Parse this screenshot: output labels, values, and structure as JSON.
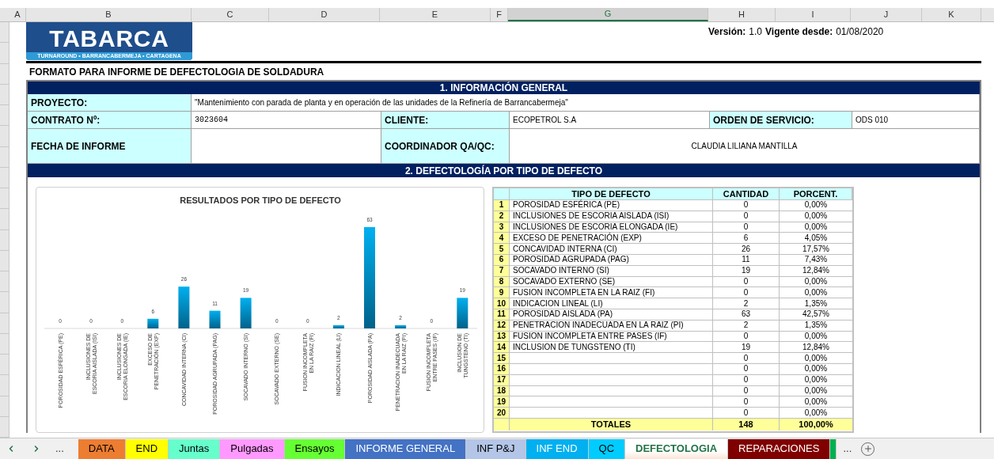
{
  "column_headers": [
    {
      "label": "A",
      "selected": false
    },
    {
      "label": "B",
      "selected": false
    },
    {
      "label": "C",
      "selected": false
    },
    {
      "label": "D",
      "selected": false
    },
    {
      "label": "E",
      "selected": false
    },
    {
      "label": "F",
      "selected": false
    },
    {
      "label": "G",
      "selected": true
    },
    {
      "label": "H",
      "selected": false
    },
    {
      "label": "I",
      "selected": false
    },
    {
      "label": "J",
      "selected": false
    },
    {
      "label": "K",
      "selected": false
    }
  ],
  "logo": {
    "name": "TABARCA",
    "tagline": "TURNAROUND • BARRANCABERMEJA • CARTAGENA"
  },
  "version": {
    "version_label": "Versión:",
    "version_value": "1.0",
    "valid_label": "Vigente desde:",
    "valid_value": "01/08/2020"
  },
  "form_title": "FORMATO PARA INFORME DE DEFECTOLOGIA DE SOLDADURA",
  "section_1": {
    "title": "1. INFORMACIÓN GENERAL",
    "proyecto": {
      "label": "PROYECTO:",
      "value": "\"Mantenimiento con parada de planta y en operación de las unidades de la Refinería de Barrancabermeja\""
    },
    "contrato": {
      "label": "CONTRATO Nº:",
      "value": "3023604"
    },
    "cliente": {
      "label": "CLIENTE:",
      "value": "ECOPETROL S.A"
    },
    "orden": {
      "label": "ORDEN DE SERVICIO:",
      "value": "ODS 010"
    },
    "fecha": {
      "label": "FECHA DE INFORME"
    },
    "coordinador": {
      "label": "COORDINADOR QA/QC:",
      "value": "CLAUDIA LILIANA MANTILLA"
    }
  },
  "section_2": {
    "title": "2. DEFECTOLOGÍA POR TIPO DE DEFECTO",
    "chart_data": {
      "type": "bar",
      "title": "RESULTADOS POR TIPO DE DEFECTO",
      "data_labels": true,
      "categories": [
        "POROSIDAD ESFÉRICA (PE)",
        "INCLUSIONES DE ESCORIA AISLADA (ISI)",
        "INCLUSIONES DE ESCORIA ELONGADA (IE)",
        "EXCESO DE PENETRACIÓN (EXP)",
        "CONCAVIDAD INTERNA (CI)",
        "POROSIDAD AGRUPADA (PAG)",
        "SOCAVADO INTERNO (SI)",
        "SOCAVADO EXTERNO (SE)",
        "FUSION INCOMPLETA EN LA RAIZ (FI)",
        "INDICACION LINEAL (LI)",
        "POROSIDAD AISLADA (PA)",
        "PENETRACION INADECUADA EN LA RAIZ (PI)",
        "FUSION INCOMPLETA ENTRE PASES (IF)",
        "INCLUSION DE TUNGSTENO (TI)"
      ],
      "series": [
        {
          "color": "#00b0f0",
          "values": [
            0,
            0,
            0,
            6,
            26,
            11,
            19,
            0,
            0,
            2,
            63,
            2,
            0,
            19
          ]
        }
      ]
    },
    "table": {
      "columns": [
        "TIPO DE DEFECTO",
        "CANTIDAD",
        "PORCENT."
      ],
      "rows": [
        {
          "number": "1",
          "defect": "POROSIDAD ESFÉRICA (PE)",
          "quantity": "0",
          "percent": "0,00%"
        },
        {
          "number": "2",
          "defect": "INCLUSIONES DE ESCORIA AISLADA (ISI)",
          "quantity": "0",
          "percent": "0,00%"
        },
        {
          "number": "3",
          "defect": "INCLUSIONES DE ESCORIA ELONGADA (IE)",
          "quantity": "0",
          "percent": "0,00%"
        },
        {
          "number": "4",
          "defect": "EXCESO DE PENETRACIÓN (EXP)",
          "quantity": "6",
          "percent": "4,05%"
        },
        {
          "number": "5",
          "defect": "CONCAVIDAD INTERNA (CI)",
          "quantity": "26",
          "percent": "17,57%"
        },
        {
          "number": "6",
          "defect": "POROSIDAD AGRUPADA (PAG)",
          "quantity": "11",
          "percent": "7,43%"
        },
        {
          "number": "7",
          "defect": "SOCAVADO INTERNO (SI)",
          "quantity": "19",
          "percent": "12,84%"
        },
        {
          "number": "8",
          "defect": "SOCAVADO EXTERNO (SE)",
          "quantity": "0",
          "percent": "0,00%"
        },
        {
          "number": "9",
          "defect": "FUSION INCOMPLETA EN LA RAIZ (FI)",
          "quantity": "0",
          "percent": "0,00%"
        },
        {
          "number": "10",
          "defect": "INDICACION LINEAL (LI)",
          "quantity": "2",
          "percent": "1,35%"
        },
        {
          "number": "11",
          "defect": "POROSIDAD AISLADA (PA)",
          "quantity": "63",
          "percent": "42,57%"
        },
        {
          "number": "12",
          "defect": "PENETRACION INADECUADA EN LA RAIZ (PI)",
          "quantity": "2",
          "percent": "1,35%"
        },
        {
          "number": "13",
          "defect": "FUSION INCOMPLETA ENTRE PASES (IF)",
          "quantity": "0",
          "percent": "0,00%"
        },
        {
          "number": "14",
          "defect": "INCLUSION DE TUNGSTENO (TI)",
          "quantity": "19",
          "percent": "12,84%"
        },
        {
          "number": "15",
          "quantity": "0",
          "percent": "0,00%"
        },
        {
          "number": "16",
          "quantity": "0",
          "percent": "0,00%"
        },
        {
          "number": "17",
          "quantity": "0",
          "percent": "0,00%"
        },
        {
          "number": "18",
          "quantity": "0",
          "percent": "0,00%"
        },
        {
          "number": "19",
          "quantity": "0",
          "percent": "0,00%"
        },
        {
          "number": "20",
          "quantity": "0",
          "percent": "0,00%"
        }
      ],
      "totals": {
        "label": "TOTALES",
        "quantity": "148",
        "percent": "100,00%"
      }
    }
  },
  "sheet_nav": {
    "more_left": "...",
    "more_right": "..."
  },
  "sheet_tabs": [
    {
      "label": "DATA",
      "color": "#ed7d31",
      "selected": false
    },
    {
      "label": "END",
      "color": "#ffff00",
      "selected": false
    },
    {
      "label": "Juntas",
      "color": "#66ffcc",
      "selected": false
    },
    {
      "label": "Pulgadas",
      "color": "#ff99ff",
      "selected": false
    },
    {
      "label": "Ensayos",
      "color": "#66ff33",
      "selected": false
    },
    {
      "label": "INFORME GENERAL",
      "color": "#4472c4",
      "selected": false
    },
    {
      "label": "INF P&J",
      "color": "#b4c6e7",
      "selected": false
    },
    {
      "label": "INF END",
      "color": "#00b0f0",
      "selected": false
    },
    {
      "label": "QC",
      "color": "#00ccff",
      "selected": false
    },
    {
      "label": "DEFECTOLOGIA",
      "color": "#fce4d6",
      "selected": true
    },
    {
      "label": "REPARACIONES",
      "color": "#800000",
      "selected": false
    },
    {
      "color": "#00b050",
      "selected": false
    }
  ]
}
